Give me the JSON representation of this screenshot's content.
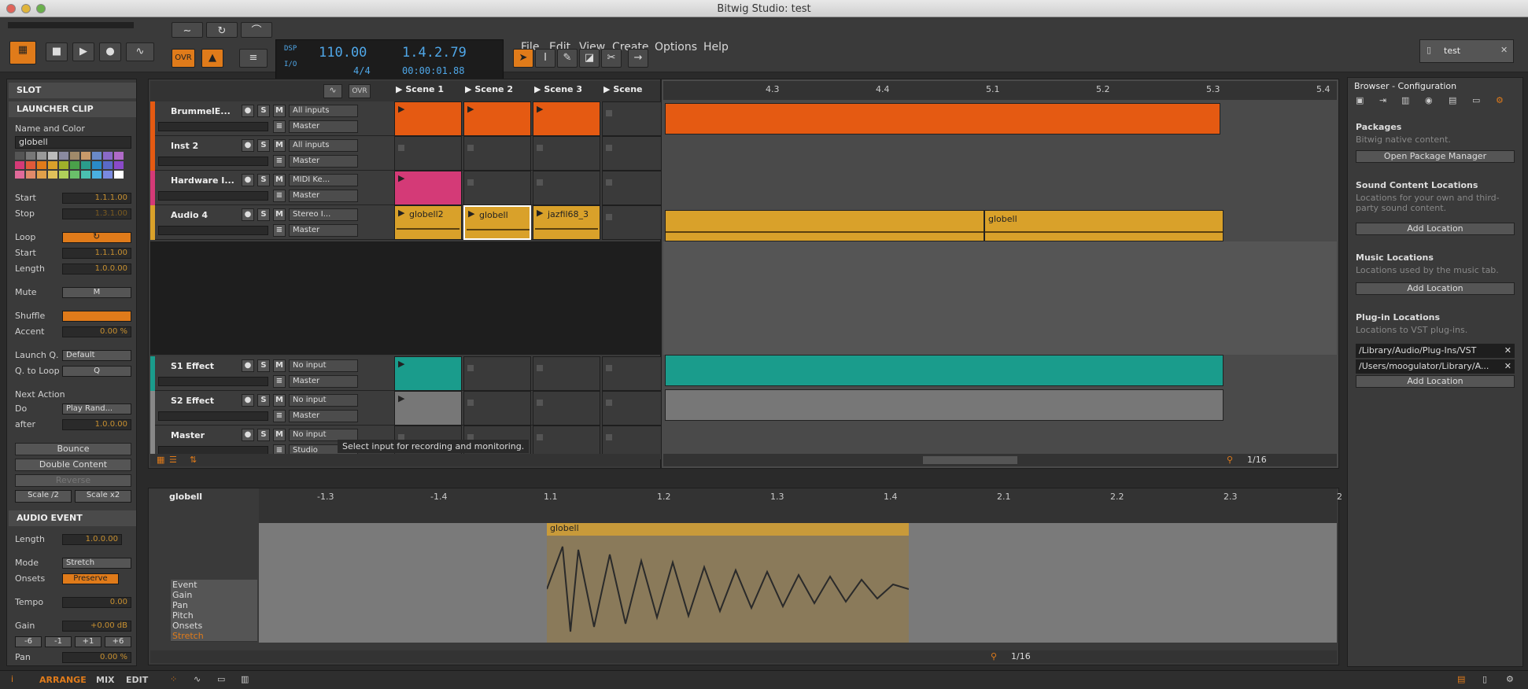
{
  "window": {
    "title": "Bitwig Studio: test"
  },
  "transport": {
    "tempo": "110.00",
    "position": "1.4.2.79",
    "signature": "4/4",
    "time": "00:00:01.88",
    "dsp": "DSP",
    "io": "I/O",
    "ovr": "OVR"
  },
  "menu": [
    "File",
    "Edit",
    "View",
    "Create",
    "Options",
    "Help"
  ],
  "doc_tab": "test",
  "inspector": {
    "slot_header": "SLOT",
    "launcher_header": "LAUNCHER CLIP",
    "name_color_label": "Name and Color",
    "clip_name": "globell",
    "start_label": "Start",
    "start": "1.1.1.00",
    "stop_label": "Stop",
    "stop": "1.3.1.00",
    "loop_label": "Loop",
    "loop_start_label": "Start",
    "loop_start": "1.1.1.00",
    "length_label": "Length",
    "length": "1.0.0.00",
    "mute_label": "Mute",
    "mute_btn": "M",
    "shuffle_label": "Shuffle",
    "accent_label": "Accent",
    "accent": "0.00 %",
    "launchq_label": "Launch Q.",
    "launchq": "Default",
    "qtoloop_label": "Q. to Loop",
    "qtoloop": "Q",
    "next_action_label": "Next Action",
    "do_label": "Do",
    "do": "Play Rand...",
    "after_label": "after",
    "after": "1.0.0.00",
    "bounce": "Bounce",
    "double": "Double Content",
    "reverse": "Reverse",
    "scale_half": "Scale /2",
    "scale_x2": "Scale x2",
    "audio_event_header": "AUDIO EVENT",
    "ae_length_label": "Length",
    "ae_length": "1.0.0.00",
    "mode_label": "Mode",
    "mode": "Stretch",
    "onsets_label": "Onsets",
    "onsets": "Preserve",
    "tempo_label": "Tempo",
    "tempo": "0.00",
    "gain_label": "Gain",
    "gain": "+0.00 dB",
    "gain_steps": [
      "-6",
      "-1",
      "+1",
      "+6"
    ],
    "pan_label": "Pan",
    "pan": "0.00 %"
  },
  "scenes": [
    "Scene 1",
    "Scene 2",
    "Scene 3",
    "Scene"
  ],
  "tracks": [
    {
      "name": "BrummelE...",
      "input": "All inputs",
      "output": "Master",
      "color": "#e55a12"
    },
    {
      "name": "Inst 2",
      "input": "All inputs",
      "output": "Master",
      "color": "#e55a12"
    },
    {
      "name": "Hardware I...",
      "input": "MIDI Ke...",
      "output": "Master",
      "color": "#d43a77"
    },
    {
      "name": "Audio 4",
      "input": "Stereo I...",
      "output": "Master",
      "color": "#d9a12a"
    },
    {
      "name": "S1 Effect",
      "input": "No input",
      "output": "Master",
      "color": "#1a9c8c"
    },
    {
      "name": "S2 Effect",
      "input": "No input",
      "output": "Master",
      "color": "#888888"
    },
    {
      "name": "Master",
      "input": "No input",
      "output": "Studio",
      "color": "#888888"
    }
  ],
  "audio_clips": [
    "globell2",
    "globell",
    "jazfil68_3"
  ],
  "tooltip": "Select input for recording and monitoring.",
  "arranger": {
    "ruler": [
      "4.3",
      "4.4",
      "5.1",
      "5.2",
      "5.3",
      "5.4"
    ],
    "audio_clip_name": "globell",
    "quant": "1/16"
  },
  "editor": {
    "clip_name": "globell",
    "ruler": [
      "-1.3",
      "-1.4",
      "1.1",
      "1.2",
      "1.3",
      "1.4",
      "2.1",
      "2.2",
      "2.3",
      "2"
    ],
    "event_name": "globell",
    "lanes": [
      "Event",
      "Gain",
      "Pan",
      "Pitch",
      "Onsets",
      "Stretch"
    ],
    "quant": "1/16"
  },
  "browser": {
    "title": "Browser - Configuration",
    "packages_header": "Packages",
    "packages_sub": "Bitwig native content.",
    "open_pm": "Open Package Manager",
    "sound_header": "Sound Content Locations",
    "sound_sub": "Locations for your own and third-party sound content.",
    "add_location": "Add Location",
    "music_header": "Music Locations",
    "music_sub": "Locations used by the music tab.",
    "plugin_header": "Plug-in Locations",
    "plugin_sub": "Locations to VST plug-ins.",
    "plugin_paths": [
      "/Library/Audio/Plug-Ins/VST",
      "/Users/moogulator/Library/A..."
    ]
  },
  "status": {
    "arrange": "ARRANGE",
    "mix": "MIX",
    "edit": "EDIT"
  }
}
